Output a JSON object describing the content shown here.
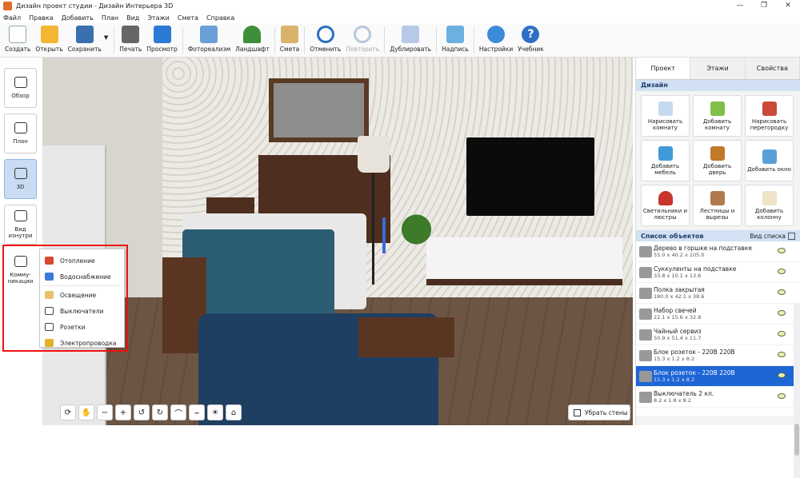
{
  "window": {
    "title": "Дизайн проект студии - Дизайн Интерьера 3D"
  },
  "menu": [
    "Файл",
    "Правка",
    "Добавить",
    "План",
    "Вид",
    "Этажи",
    "Смета",
    "Справка"
  ],
  "toolbar": {
    "create": "Создать",
    "open": "Открыть",
    "save": "Сохранить",
    "print": "Печать",
    "preview": "Просмотр",
    "photo": "Фотореализм",
    "landscape": "Ландшафт",
    "estimate": "Смета",
    "undo": "Отменить",
    "redo": "Повторить",
    "duplicate": "Дублировать",
    "labels": "Надпись",
    "settings": "Настройки",
    "tutorial": "Учебник"
  },
  "views": {
    "overview": "Обзор",
    "plan": "План",
    "view3d": "3D",
    "inside": "Вид изнутри",
    "comms": "Комму-никации"
  },
  "popup": [
    "Отопление",
    "Водоснабжение",
    "Освещение",
    "Выключатели",
    "Розетки",
    "Электропроводка"
  ],
  "bottom": {
    "remove_walls": "Убрать стены"
  },
  "panel": {
    "tabs": [
      "Проект",
      "Этажи",
      "Свойства"
    ],
    "design_title": "Дизайн",
    "design_buttons": [
      "Нарисовать комнату",
      "Добавить комнату",
      "Нарисовать перегородку",
      "Добавить мебель",
      "Добавить дверь",
      "Добавить окно",
      "Светильники и люстры",
      "Лестницы и вырезы",
      "Добавить колонну"
    ],
    "objects_title": "Список объектов",
    "view_list": "Вид списка",
    "objects": [
      {
        "name": "Дерево в горшке на подставке",
        "size": "55.0 x 40.2 x 105.0"
      },
      {
        "name": "Суккуленты на подставке",
        "size": "33.8 x 10.1 x 13.6"
      },
      {
        "name": "Полка закрытая",
        "size": "180.0 x 42.1 x 38.6"
      },
      {
        "name": "Набор свечей",
        "size": "22.1 x 15.6 x 32.8"
      },
      {
        "name": "Чайный сервиз",
        "size": "50.9 x 51.4 x 11.7"
      },
      {
        "name": "Блок розеток - 220В 220В",
        "size": "15.3 x 1.2 x 8.2"
      },
      {
        "name": "Блок розеток - 220В 220В",
        "size": "15.3 x 1.2 x 8.2"
      },
      {
        "name": "Выключатель 2 кл.",
        "size": "8.2 x 1.8 x 8.2"
      }
    ]
  }
}
